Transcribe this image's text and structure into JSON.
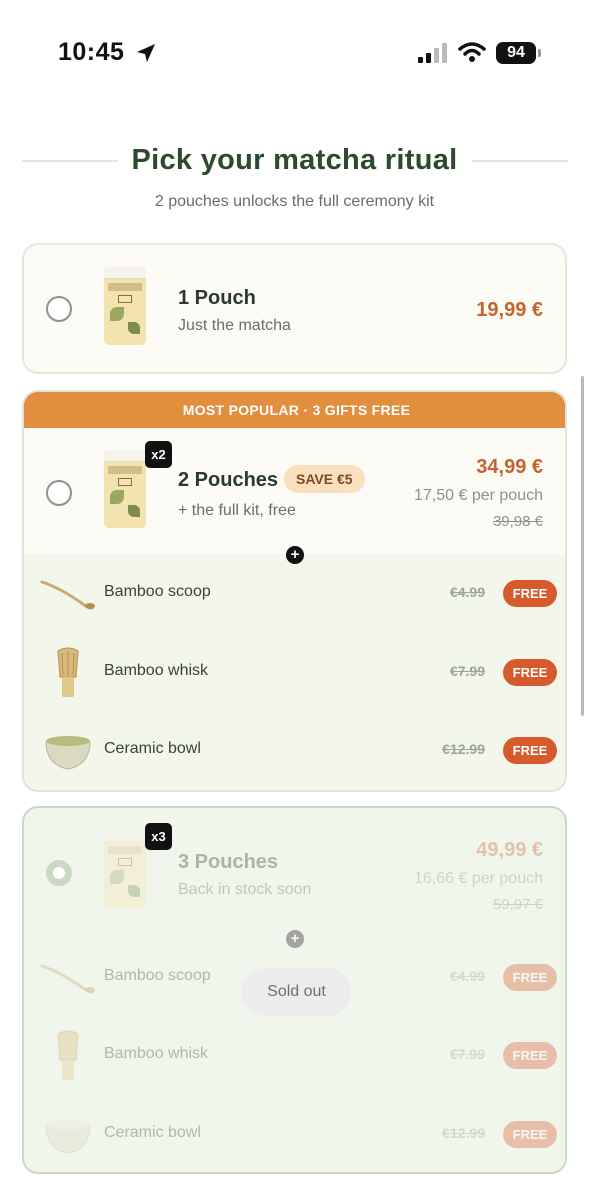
{
  "status_bar": {
    "time": "10:45",
    "battery": "94",
    "icons": [
      "location-arrow-icon",
      "cellular-signal-icon",
      "wifi-icon",
      "battery-icon"
    ]
  },
  "header": {
    "title": "Pick your matcha ritual",
    "subtitle": "2 pouches unlocks the full ceremony kit"
  },
  "options": [
    {
      "title": "1 Pouch",
      "subtitle": "Just the matcha",
      "price": "19,99 €",
      "selected": false
    },
    {
      "banner": "MOST POPULAR · 3 GIFTS FREE",
      "qty_badge": "x2",
      "title": "2 Pouches",
      "save_badge": "SAVE €5",
      "subtitle": "+ the full kit, free",
      "price": "34,99 €",
      "per_pouch": "17,50 € per pouch",
      "old_price": "39,98 €",
      "selected": false,
      "kit": [
        {
          "name": "Bamboo scoop",
          "old_price": "€4.99",
          "badge": "FREE",
          "icon": "bamboo-scoop-icon"
        },
        {
          "name": "Bamboo whisk",
          "old_price": "€7.99",
          "badge": "FREE",
          "icon": "bamboo-whisk-icon"
        },
        {
          "name": "Ceramic bowl",
          "old_price": "€12.99",
          "badge": "FREE",
          "icon": "ceramic-bowl-icon"
        }
      ]
    },
    {
      "qty_badge": "x3",
      "title": "3 Pouches",
      "subtitle": "Back in stock soon",
      "price": "49,99 €",
      "per_pouch": "16,66 € per pouch",
      "old_price": "59,97 €",
      "disabled": true,
      "sold_out_label": "Sold out",
      "kit": [
        {
          "name": "Bamboo scoop",
          "old_price": "€4.99",
          "badge": "FREE",
          "icon": "bamboo-scoop-icon"
        },
        {
          "name": "Bamboo whisk",
          "old_price": "€7.99",
          "badge": "FREE",
          "icon": "bamboo-whisk-icon"
        },
        {
          "name": "Ceramic bowl",
          "old_price": "€12.99",
          "badge": "FREE",
          "icon": "ceramic-bowl-icon"
        }
      ]
    }
  ],
  "colors": {
    "title_green": "#2d4a2e",
    "price_orange": "#c8622e",
    "banner_orange": "#e28e3f",
    "free_badge": "#d65a2b",
    "kit_background": "#f2f6eb"
  }
}
